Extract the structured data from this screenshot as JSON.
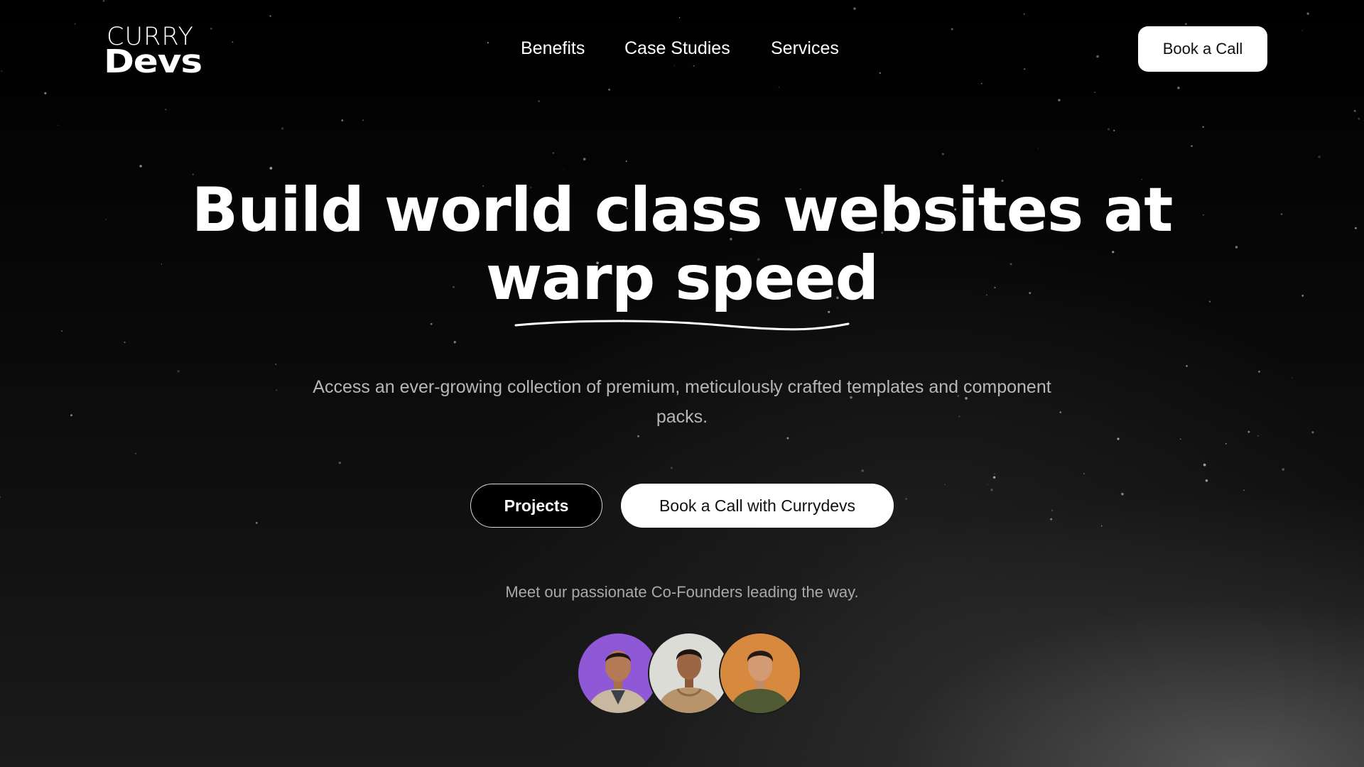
{
  "brand": {
    "logo_top": "CURRY",
    "logo_bottom": "Devs"
  },
  "nav": {
    "items": [
      {
        "label": "Benefits"
      },
      {
        "label": "Case Studies"
      },
      {
        "label": "Services"
      }
    ],
    "cta_label": "Book a Call"
  },
  "hero": {
    "headline_line1": "Build world class websites at",
    "headline_line2": "warp speed",
    "subtitle_line1": "Access an ever-growing collection of premium, meticulously crafted templates and component",
    "subtitle_line2": "packs.",
    "primary_button": "Projects",
    "secondary_button": "Book a Call with Currydevs",
    "cofounders_text": "Meet our passionate Co-Founders leading the way."
  },
  "cofounders": [
    {
      "background": "#8e58d6",
      "hoodie": "#c9b8a0"
    },
    {
      "background": "#dcdcd6",
      "hoodie": "#b8946a"
    },
    {
      "background": "#d7893f",
      "hoodie": "#4f5a32"
    }
  ],
  "colors": {
    "background": "#000000",
    "text": "#ffffff",
    "muted_text": "#b7b7b7",
    "button_light": "#ffffff"
  }
}
